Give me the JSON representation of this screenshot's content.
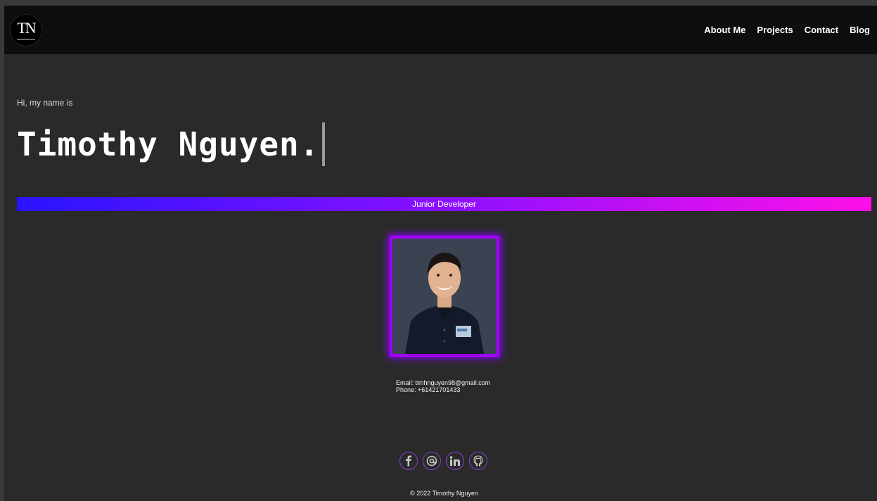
{
  "nav": {
    "logo_text": "TN",
    "links": [
      "About Me",
      "Projects",
      "Contact",
      "Blog"
    ]
  },
  "hero": {
    "greeting": "Hi, my name is",
    "name": "Timothy Nguyen.",
    "role": "Junior Developer"
  },
  "contact": {
    "email": "Email: timhnguyen98@gmail.com",
    "phone": "Phone: +61421701433"
  },
  "socials": [
    "facebook-icon",
    "email-at-icon",
    "linkedin-icon",
    "github-icon"
  ],
  "footer": {
    "copyright": "© 2022 Timothy Nguyen"
  },
  "colors": {
    "background": "#2a2a2a",
    "navbar": "#0e0e0e",
    "accent_purple": "#a100ff",
    "gradient_start": "#2a14ff",
    "gradient_end": "#ff10e8"
  }
}
